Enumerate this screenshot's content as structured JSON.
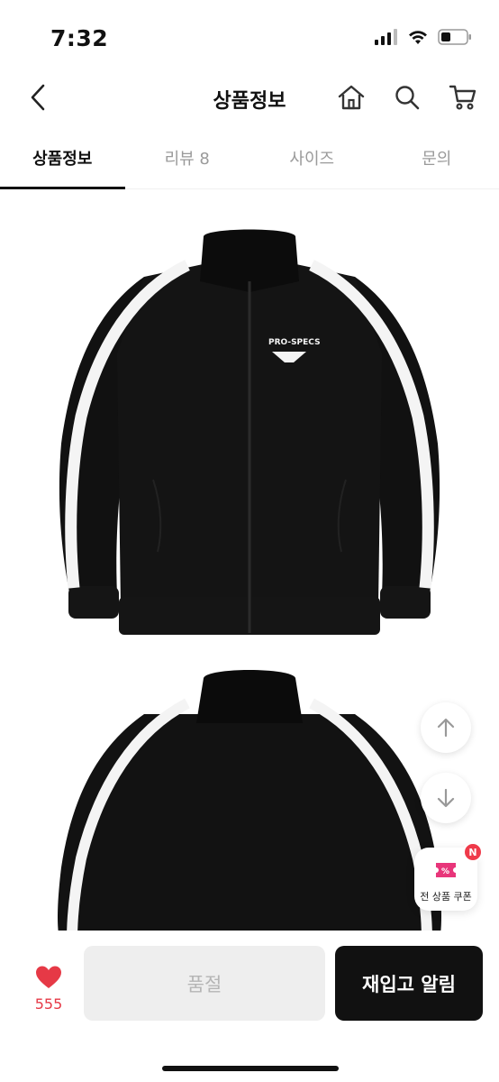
{
  "status_bar": {
    "time": "7:32"
  },
  "header": {
    "title": "상품정보",
    "icons": [
      "back-icon",
      "home-icon",
      "search-icon",
      "cart-icon"
    ]
  },
  "tabs": [
    {
      "label": "상품정보",
      "active": true
    },
    {
      "label": "리뷰 8",
      "active": false
    },
    {
      "label": "사이즈",
      "active": false
    },
    {
      "label": "문의",
      "active": false
    }
  ],
  "product": {
    "images": [
      "jacket-front-image",
      "jacket-back-image"
    ],
    "logo_text": "PRO-SPECS"
  },
  "floating": {
    "scroll_up_icon": "arrow-up-icon",
    "scroll_down_icon": "arrow-down-icon",
    "coupon_label": "전 상품 쿠폰",
    "coupon_badge": "N"
  },
  "bottom_bar": {
    "like_count": "555",
    "soldout_label": "품절",
    "restock_label": "재입고 알림"
  },
  "colors": {
    "accent": "#111111",
    "like": "#e63946",
    "badge": "#ef3a4a",
    "coupon": "#e8357a"
  }
}
